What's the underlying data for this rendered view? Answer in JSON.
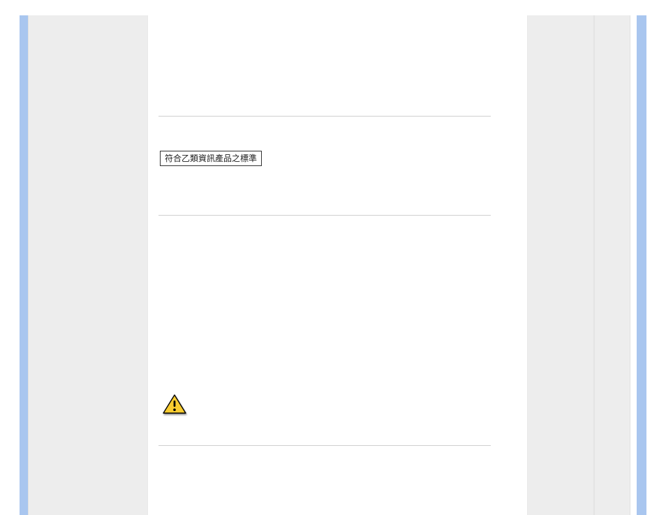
{
  "boxed_text": "符合乙類資訊產品之標準"
}
